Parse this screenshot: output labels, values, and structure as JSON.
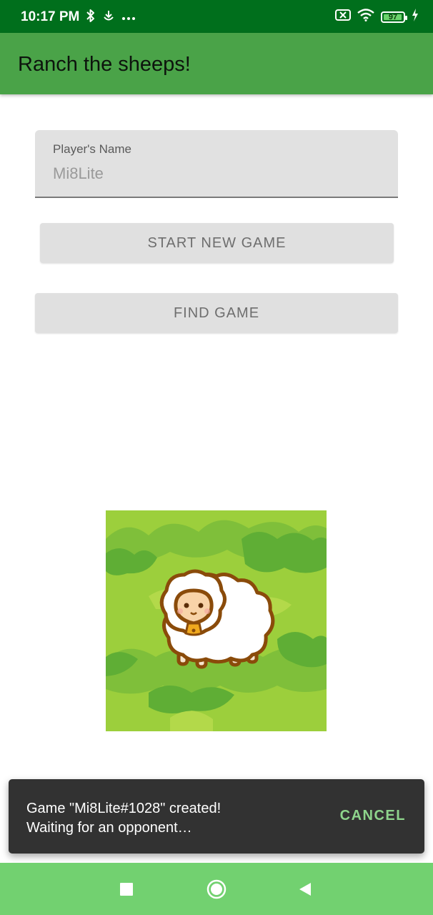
{
  "status_bar": {
    "time": "10:17 PM",
    "battery_level": "97",
    "left_icons": [
      "bluetooth-icon",
      "download-icon",
      "more-icon"
    ],
    "right_icons": [
      "sim-off-icon",
      "wifi-icon",
      "battery-icon",
      "charging-icon"
    ]
  },
  "app_bar": {
    "title": "Ranch the sheeps!"
  },
  "player_field": {
    "label": "Player's Name",
    "value": "Mi8Lite"
  },
  "buttons": {
    "start": "START NEW GAME",
    "find": "FIND GAME"
  },
  "illustration": {
    "name": "sheep-on-grass-image"
  },
  "snackbar": {
    "line1": "Game \"Mi8Lite#1028\" created!",
    "line2": "Waiting for an opponent…",
    "action": "CANCEL"
  },
  "nav": {
    "icons": [
      "recents-icon",
      "home-icon",
      "back-icon"
    ]
  },
  "colors": {
    "status_bar": "#006f1c",
    "app_bar": "#4aa348",
    "nav_bar": "#72d170",
    "snackbar": "#323232",
    "snack_action": "#8ed58c"
  }
}
